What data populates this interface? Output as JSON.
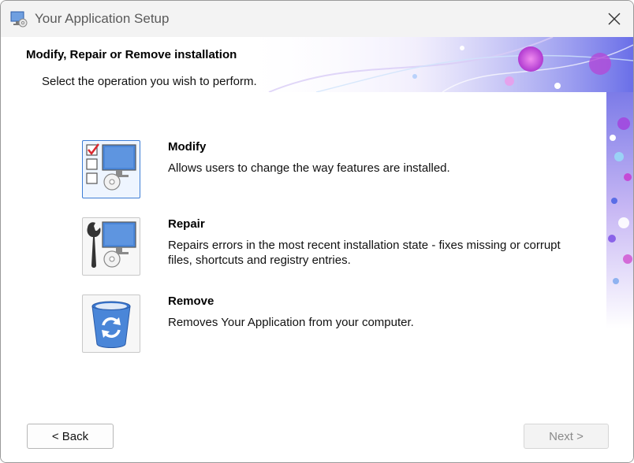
{
  "window": {
    "title": "Your Application Setup",
    "app_icon": "monitor-cd-icon"
  },
  "header": {
    "title": "Modify, Repair or Remove installation",
    "subtitle": "Select the operation you wish to perform."
  },
  "options": [
    {
      "title": "Modify",
      "description": "Allows users to change the way features are installed.",
      "icon": "modify-features-icon",
      "selected": true
    },
    {
      "title": "Repair",
      "description": "Repairs errors in the most recent installation state - fixes missing or corrupt files, shortcuts and registry entries.",
      "icon": "repair-wrench-icon",
      "selected": false
    },
    {
      "title": "Remove",
      "description": "Removes Your Application from your computer.",
      "icon": "recycle-bin-icon",
      "selected": false
    }
  ],
  "buttons": {
    "back": "< Back",
    "next": "Next >",
    "next_enabled": false
  },
  "colors": {
    "accent": "#3d7dd6",
    "icon_blue": "#4a86d8",
    "check_red": "#d9272e"
  }
}
